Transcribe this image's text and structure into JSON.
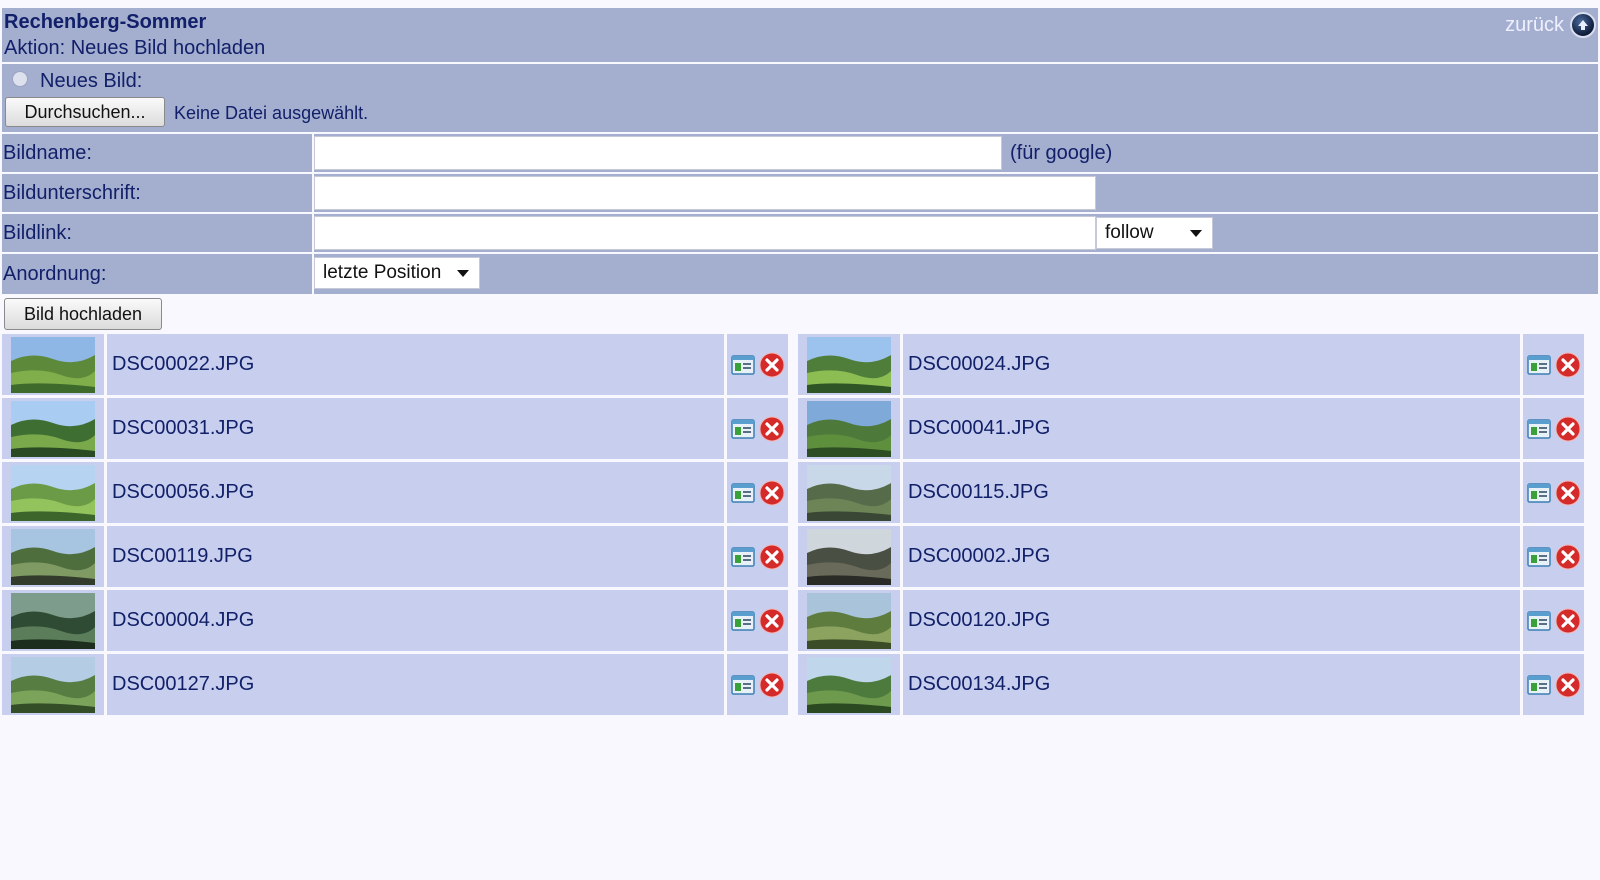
{
  "header": {
    "title": "Rechenberg-Sommer",
    "action": "Aktion: Neues Bild hochladen",
    "back_label": "zurück"
  },
  "new_image": {
    "label": "Neues Bild:",
    "browse_label": "Durchsuchen...",
    "no_file_text": "Keine Datei ausgewählt."
  },
  "form": {
    "name_label": "Bildname:",
    "name_hint": "(für google)",
    "name_value": "",
    "caption_label": "Bildunterschrift:",
    "caption_value": "",
    "link_label": "Bildlink:",
    "link_value": "",
    "link_rel_selected": "follow",
    "order_label": "Anordnung:",
    "order_selected": "letzte Position",
    "upload_label": "Bild hochladen"
  },
  "images": [
    {
      "name": "DSC00022.JPG"
    },
    {
      "name": "DSC00024.JPG"
    },
    {
      "name": "DSC00031.JPG"
    },
    {
      "name": "DSC00041.JPG"
    },
    {
      "name": "DSC00056.JPG"
    },
    {
      "name": "DSC00115.JPG"
    },
    {
      "name": "DSC00119.JPG"
    },
    {
      "name": "DSC00002.JPG"
    },
    {
      "name": "DSC00004.JPG"
    },
    {
      "name": "DSC00120.JPG"
    },
    {
      "name": "DSC00127.JPG"
    },
    {
      "name": "DSC00134.JPG"
    }
  ],
  "icons": {
    "back": "globe-arrow-icon",
    "edit": "edit-image-icon",
    "delete": "delete-icon"
  },
  "colors": {
    "header_bg": "#a4aecf",
    "row_bg": "#c8cfee",
    "text": "#12206a",
    "delete_red": "#d42a2a"
  }
}
